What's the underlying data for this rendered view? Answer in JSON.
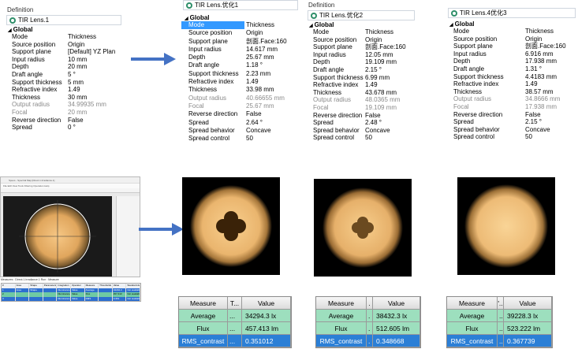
{
  "panels": [
    {
      "id": "p1",
      "header": "Definition",
      "lens_name": "TIR Lens.1",
      "group": "Global",
      "rows": [
        {
          "k": "Mode",
          "v": "Thickness",
          "gray": false,
          "sel": false
        },
        {
          "k": "Source position",
          "v": "Origin",
          "gray": false,
          "sel": false
        },
        {
          "k": "Support plane",
          "v": "[Default] YZ Plan",
          "gray": false,
          "sel": false
        },
        {
          "k": "Input radius",
          "v": "10 mm",
          "gray": false,
          "sel": false
        },
        {
          "k": "Depth",
          "v": "20 mm",
          "gray": false,
          "sel": false
        },
        {
          "k": "Draft angle",
          "v": "5 °",
          "gray": false,
          "sel": false
        },
        {
          "k": "Support thickness",
          "v": "5 mm",
          "gray": false,
          "sel": false
        },
        {
          "k": "Refractive index",
          "v": "1.49",
          "gray": false,
          "sel": false
        },
        {
          "k": "Thickness",
          "v": "30 mm",
          "gray": false,
          "sel": false
        },
        {
          "k": "Output radius",
          "v": "34.99935 mm",
          "gray": true,
          "sel": false
        },
        {
          "k": "Focal",
          "v": "20 mm",
          "gray": true,
          "sel": false
        },
        {
          "k": "Reverse direction",
          "v": "False",
          "gray": false,
          "sel": false
        },
        {
          "k": "Spread",
          "v": "0 °",
          "gray": false,
          "sel": false
        }
      ]
    },
    {
      "id": "p2",
      "header": "",
      "lens_name": "TIR Lens.优化1",
      "group": "Global",
      "rows": [
        {
          "k": "Mode",
          "v": "Thickness",
          "gray": false,
          "sel": true
        },
        {
          "k": "Source position",
          "v": "Origin",
          "gray": false,
          "sel": false
        },
        {
          "k": "Support plane",
          "v": "剖面.Face:160",
          "gray": false,
          "sel": false
        },
        {
          "k": "Input radius",
          "v": "14.617 mm",
          "gray": false,
          "sel": false
        },
        {
          "k": "Depth",
          "v": "25.67 mm",
          "gray": false,
          "sel": false
        },
        {
          "k": "Draft angle",
          "v": "1.18 °",
          "gray": false,
          "sel": false
        },
        {
          "k": "Support thickness",
          "v": "2.23 mm",
          "gray": false,
          "sel": false
        },
        {
          "k": "Refractive index",
          "v": "1.49",
          "gray": false,
          "sel": false
        },
        {
          "k": "Thickness",
          "v": "33.98 mm",
          "gray": false,
          "sel": false
        },
        {
          "k": "Output radius",
          "v": "40.66655 mm",
          "gray": true,
          "sel": false
        },
        {
          "k": "Focal",
          "v": "25.67 mm",
          "gray": true,
          "sel": false
        },
        {
          "k": "Reverse direction",
          "v": "False",
          "gray": false,
          "sel": false
        },
        {
          "k": "Spread",
          "v": "2.64 °",
          "gray": false,
          "sel": false
        },
        {
          "k": "Spread behavior",
          "v": "Concave",
          "gray": false,
          "sel": false
        },
        {
          "k": "Spread control",
          "v": "50",
          "gray": false,
          "sel": false
        }
      ]
    },
    {
      "id": "p3",
      "header": "Definition",
      "lens_name": "TIR Lens.优化2",
      "group": "Global",
      "rows": [
        {
          "k": "Mode",
          "v": "Thickness",
          "gray": false,
          "sel": false
        },
        {
          "k": "Source position",
          "v": "Origin",
          "gray": false,
          "sel": false
        },
        {
          "k": "Support plane",
          "v": "剖面.Face:160",
          "gray": false,
          "sel": false
        },
        {
          "k": "Input radius",
          "v": "12.05 mm",
          "gray": false,
          "sel": false
        },
        {
          "k": "Depth",
          "v": "19.109 mm",
          "gray": false,
          "sel": false
        },
        {
          "k": "Draft angle",
          "v": "2.15 °",
          "gray": false,
          "sel": false
        },
        {
          "k": "Support thickness",
          "v": "6.99 mm",
          "gray": false,
          "sel": false
        },
        {
          "k": "Refractive index",
          "v": "1.49",
          "gray": false,
          "sel": false
        },
        {
          "k": "Thickness",
          "v": "43.678 mm",
          "gray": false,
          "sel": false
        },
        {
          "k": "Output radius",
          "v": "48.0365 mm",
          "gray": true,
          "sel": false
        },
        {
          "k": "Focal",
          "v": "19.109 mm",
          "gray": true,
          "sel": false
        },
        {
          "k": "Reverse direction",
          "v": "False",
          "gray": false,
          "sel": false
        },
        {
          "k": "Spread",
          "v": "2.48 °",
          "gray": false,
          "sel": false
        },
        {
          "k": "Spread behavior",
          "v": "Concave",
          "gray": false,
          "sel": false
        },
        {
          "k": "Spread control",
          "v": "50",
          "gray": false,
          "sel": false
        }
      ]
    },
    {
      "id": "p4",
      "header": "",
      "lens_name": "TIR Lens.4优化3",
      "group": "Global",
      "rows": [
        {
          "k": "Mode",
          "v": "Thickness",
          "gray": false,
          "sel": false
        },
        {
          "k": "Source position",
          "v": "Origin",
          "gray": false,
          "sel": false
        },
        {
          "k": "Support plane",
          "v": "剖面.Face:160",
          "gray": false,
          "sel": false
        },
        {
          "k": "Input radius",
          "v": "6.916 mm",
          "gray": false,
          "sel": false
        },
        {
          "k": "Depth",
          "v": "17.938 mm",
          "gray": false,
          "sel": false
        },
        {
          "k": "Draft angle",
          "v": "1.31 °",
          "gray": false,
          "sel": false
        },
        {
          "k": "Support thickness",
          "v": "4.4183 mm",
          "gray": false,
          "sel": false
        },
        {
          "k": "Refractive index",
          "v": "1.49",
          "gray": false,
          "sel": false
        },
        {
          "k": "Thickness",
          "v": "38.57 mm",
          "gray": false,
          "sel": false
        },
        {
          "k": "Output radius",
          "v": "34.8666 mm",
          "gray": true,
          "sel": false
        },
        {
          "k": "Focal",
          "v": "17.938 mm",
          "gray": true,
          "sel": false
        },
        {
          "k": "Reverse direction",
          "v": "False",
          "gray": false,
          "sel": false
        },
        {
          "k": "Spread",
          "v": "2.15 °",
          "gray": false,
          "sel": false
        },
        {
          "k": "Spread behavior",
          "v": "Concave",
          "gray": false,
          "sel": false
        },
        {
          "k": "Spread control",
          "v": "50",
          "gray": false,
          "sel": false
        }
      ]
    }
  ],
  "viewer": {
    "title": "Speos - Spectral Map [Direct.1.Irradiance.1]",
    "menu": "File  Edit  View  Tools  Filtering  Operation  Help",
    "measures_label": "Measures : Direct.1.Irradiance.1  Run : Measure"
  },
  "measures": [
    {
      "headers": [
        "Measure",
        "T...",
        "Value"
      ],
      "rows": [
        {
          "name": "Average",
          "mid": "...",
          "value": "34294.3 lx",
          "style": "g"
        },
        {
          "name": "Flux",
          "mid": "...",
          "value": "457.413 lm",
          "style": "g"
        },
        {
          "name": "RMS_contrast",
          "mid": "...",
          "value": "0.351012",
          "style": "b"
        }
      ]
    },
    {
      "headers": [
        "Measure",
        ".",
        "Value"
      ],
      "rows": [
        {
          "name": "Average",
          "mid": ".",
          "value": "38432.3 lx",
          "style": "g"
        },
        {
          "name": "Flux",
          "mid": ".",
          "value": "512.605 lm",
          "style": "g"
        },
        {
          "name": "RMS_contrast",
          "mid": ".",
          "value": "0.348668",
          "style": "b"
        }
      ]
    },
    {
      "headers": [
        "Measure",
        "'..",
        "Value"
      ],
      "rows": [
        {
          "name": "Average",
          "mid": "..",
          "value": "39228.3 lx",
          "style": "g"
        },
        {
          "name": "Flux",
          "mid": "..",
          "value": "523.222 lm",
          "style": "g"
        },
        {
          "name": "RMS_contrast",
          "mid": "..",
          "value": "0.367739",
          "style": "b"
        }
      ]
    }
  ],
  "colors": {
    "arrow": "#4472c4",
    "selection": "#3399ff",
    "measure_green": "#9ddfbe",
    "measure_blue": "#2b7fd6"
  },
  "icons": [
    "lens-icon",
    "arrow-right-icon"
  ]
}
